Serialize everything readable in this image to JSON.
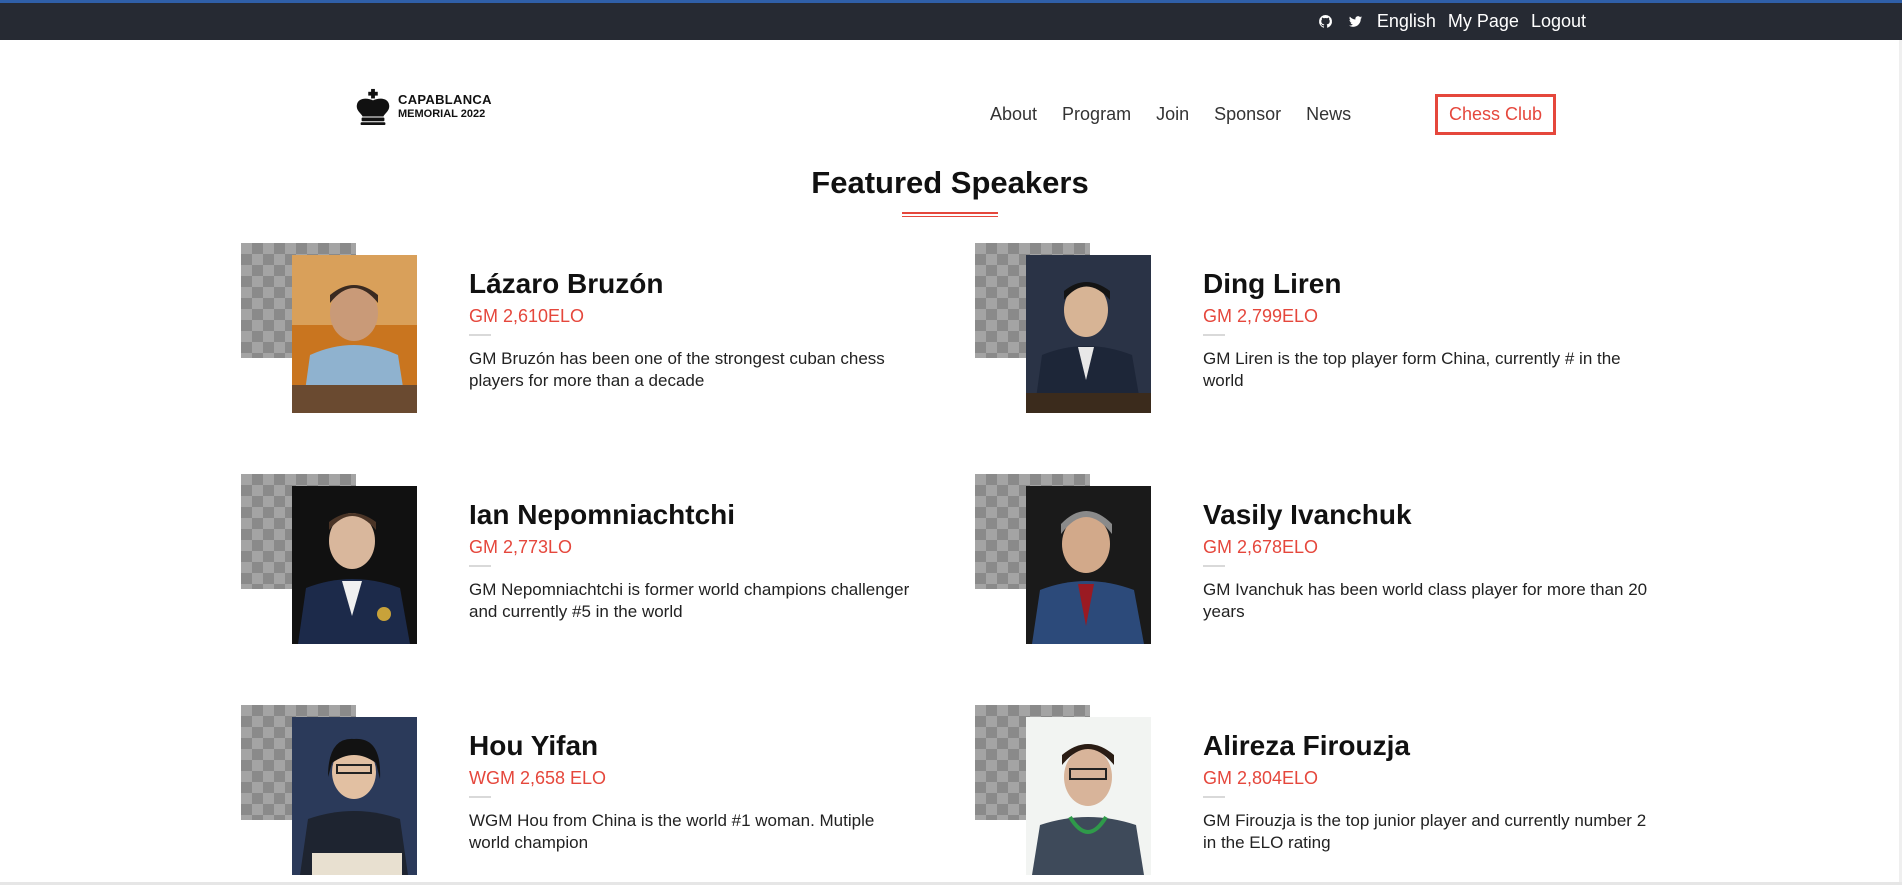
{
  "topbar": {
    "icons": [
      "github-icon",
      "twitter-icon"
    ],
    "language": "English",
    "my_page": "My Page",
    "logout": "Logout"
  },
  "logo": {
    "line1": "CAPABLANCA",
    "line2": "MEMORIAL 2022"
  },
  "nav": {
    "items": [
      "About",
      "Program",
      "Join",
      "Sponsor",
      "News"
    ],
    "cta": "Chess Club"
  },
  "section": {
    "title": "Featured Speakers"
  },
  "speakers": [
    {
      "name": "Lázaro Bruzón",
      "rating": "GM 2,610ELO",
      "description": "GM Bruzón has been one of the strongest cuban chess players for more than a decade"
    },
    {
      "name": "Ding Liren",
      "rating": "GM 2,799ELO",
      "description": "GM Liren is the top player form China, currently # in the world"
    },
    {
      "name": "Ian Nepomniachtchi",
      "rating": "GM 2,773LO",
      "description": "GM Nepomniachtchi is former world champions challenger and currently #5 in the world"
    },
    {
      "name": "Vasily Ivanchuk",
      "rating": "GM 2,678ELO",
      "description": "GM Ivanchuk has been world class player for more than 20 years"
    },
    {
      "name": "Hou Yifan",
      "rating": "WGM 2,658 ELO",
      "description": "WGM Hou from China is the world #1 woman. Mutiple world champion"
    },
    {
      "name": "Alireza Firouzja",
      "rating": "GM 2,804ELO",
      "description": "GM Firouzja is the top junior player and currently number 2 in the ELO rating"
    }
  ],
  "colors": {
    "accent": "#e5473c",
    "topbar_bg": "#262a33",
    "topbar_border": "#2f5fa8"
  }
}
